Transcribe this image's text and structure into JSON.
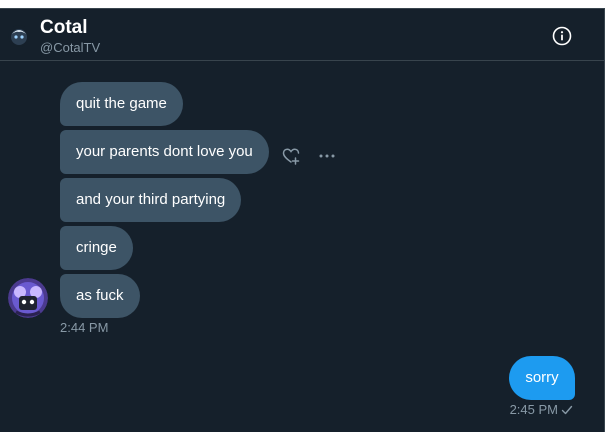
{
  "header": {
    "name": "Cotal",
    "handle": "@CotalTV",
    "info_icon": "info-icon"
  },
  "messages": [
    {
      "text": "quit the game"
    },
    {
      "text": "your parents dont love you"
    },
    {
      "text": "and your third partying"
    },
    {
      "text": "cringe"
    },
    {
      "text": "as fuck"
    }
  ],
  "incoming_time": "2:44 PM",
  "outgoing": {
    "text": "sorry",
    "time": "2:45 PM"
  },
  "actions": {
    "react_icon": "heart-plus-icon",
    "more_icon": "more-horizontal-icon"
  },
  "colors": {
    "background": "#15202b",
    "incoming_bubble": "#3d5466",
    "outgoing_bubble": "#1d9bf0",
    "secondary_text": "#8899a6",
    "divider": "#38444d"
  }
}
